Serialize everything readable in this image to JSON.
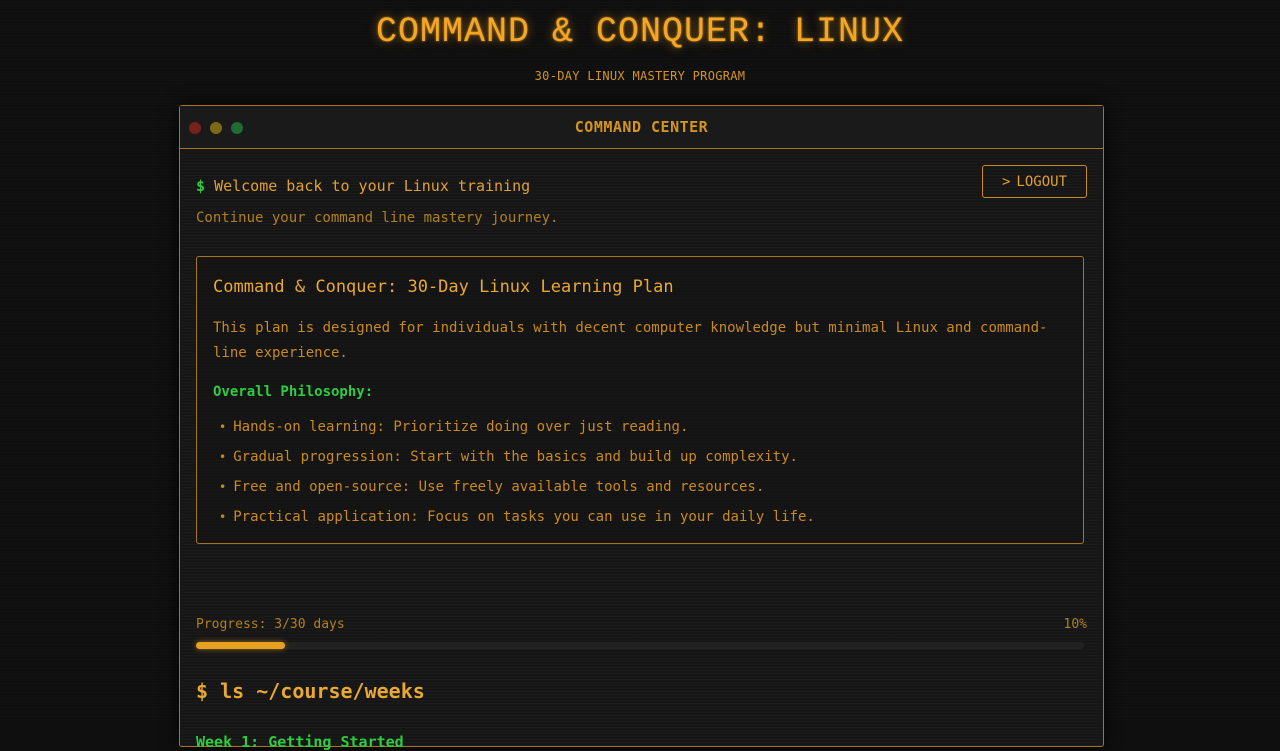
{
  "header": {
    "title": "COMMAND & CONQUER: LINUX",
    "subtitle": "30-DAY LINUX MASTERY PROGRAM"
  },
  "window": {
    "title": "COMMAND CENTER"
  },
  "welcome": {
    "prompt": "$",
    "text": "Welcome back to your Linux training",
    "subtext": "Continue your command line mastery journey."
  },
  "logout": {
    "label": "LOGOUT",
    "icon": ">"
  },
  "plan": {
    "title": "Command & Conquer: 30-Day Linux Learning Plan",
    "description": "This plan is designed for individuals with decent computer knowledge but minimal Linux and command-line experience.",
    "philosophy_heading": "Overall Philosophy:",
    "philosophy": [
      "Hands-on learning: Prioritize doing over just reading.",
      "Gradual progression: Start with the basics and build up complexity.",
      "Free and open-source: Use freely available tools and resources.",
      "Practical application: Focus on tasks you can use in your daily life."
    ]
  },
  "progress": {
    "label": "Progress: 3/30 days",
    "percent_text": "10%",
    "fraction": 0.1
  },
  "weeks": {
    "command": "$ ls ~/course/weeks",
    "first_week": "Week 1: Getting Started"
  },
  "colors": {
    "accent": "#f5a623",
    "prompt_green": "#2ecc40",
    "background": "#0f0f0f"
  }
}
